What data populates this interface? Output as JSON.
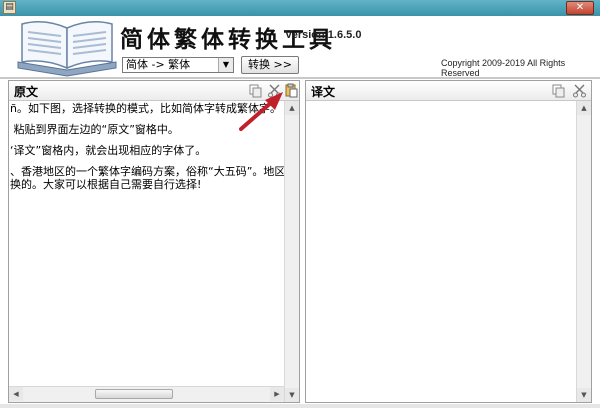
{
  "window": {
    "close_label": "✕",
    "system_icon": "app-book-icon"
  },
  "header": {
    "title": "简体繁体转换工具",
    "version": "Version 1.6.5.0",
    "copyright": "Copyright 2009-2019 All Rights Reserved"
  },
  "toolbar": {
    "mode_selected": "简体 -> 繁体",
    "convert_label": "转换 >>"
  },
  "source_panel": {
    "title": "原文",
    "icons": [
      "copy-icon",
      "cut-icon",
      "paste-icon"
    ],
    "lines": [
      "ñ。如下图，选择转换的模式，比如简体字转成繁体字。",
      " 粘贴到界面左边的“原文”窗格中。",
      "‘译文”窗格内，就会出现相应的字体了。",
      "、香港地区的一个繁体字编码方案，俗称“大五码”。地区标",
      "换的。大家可以根据自己需要自行选择!"
    ]
  },
  "target_panel": {
    "title": "译文",
    "icons": [
      "copy-icon",
      "cut-icon"
    ]
  },
  "annotation": {
    "arrow_color": "#c0202a"
  }
}
